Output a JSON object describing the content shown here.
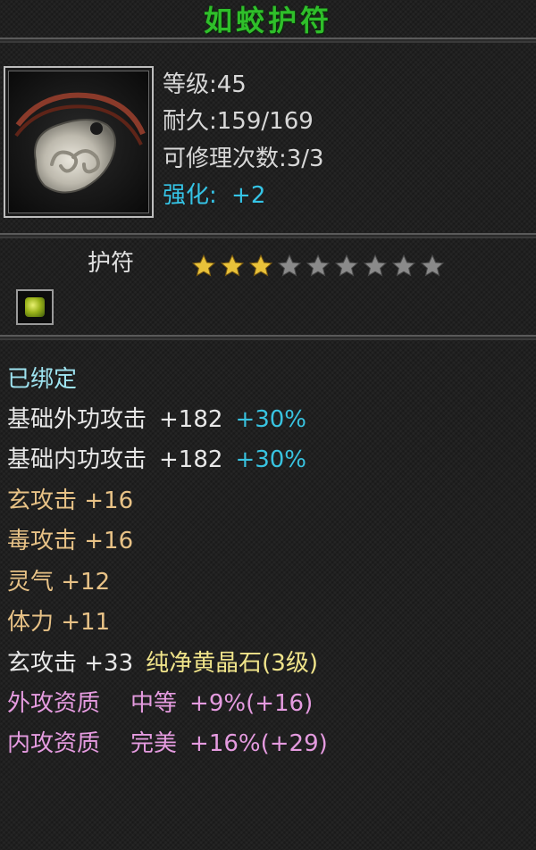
{
  "item": {
    "name": "如蛟护符",
    "level": "等级:45",
    "durability": "耐久:159/169",
    "repair": "可修理次数:3/3",
    "enhance_label": "强化:",
    "enhance_value": "+2",
    "type": "护符",
    "stars_filled": 3,
    "stars_total": 9
  },
  "attributes": {
    "bound": "已绑定",
    "outer_attack": {
      "label": "基础外功攻击",
      "value": "+182",
      "bonus": "+30%"
    },
    "inner_attack": {
      "label": "基础内功攻击",
      "value": "+182",
      "bonus": "+30%"
    },
    "xuan_attack": "玄攻击 +16",
    "poison_attack": "毒攻击 +16",
    "spirit": "灵气 +12",
    "stamina": "体力 +11",
    "gem_line": {
      "stat": "玄攻击 +33",
      "gem": "纯净黄晶石(3级)"
    },
    "outer_quality": {
      "label": "外攻资质",
      "grade": "中等",
      "value": "+9%(+16)"
    },
    "inner_quality": {
      "label": "内攻资质",
      "grade": "完美",
      "value": "+16%(+29)"
    }
  },
  "colors": {
    "title": "#2fbf2a",
    "enhance": "#35c4e6",
    "bonus": "#38c3e0",
    "basic": "#e8c286",
    "gem": "#f0e48a",
    "quality": "#e59be0",
    "star_gold": "#e9c23a",
    "star_gray": "#8a8a8a"
  },
  "icons": {
    "portrait": "jade-amulet-icon",
    "socket": "yellow-gem-icon",
    "star": "star-icon"
  }
}
